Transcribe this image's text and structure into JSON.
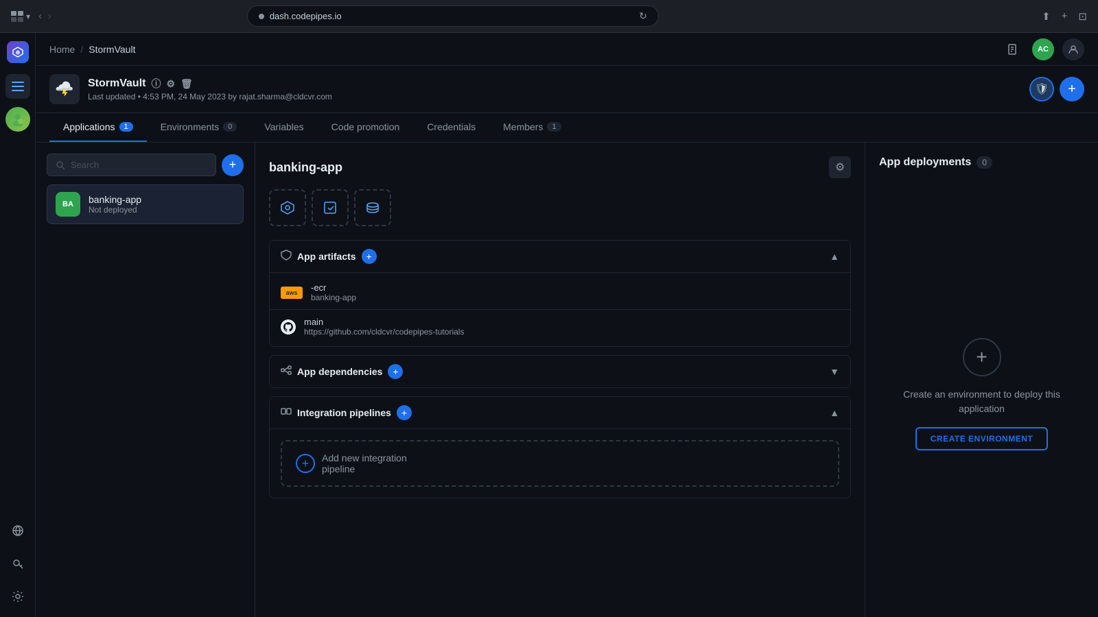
{
  "browser": {
    "url": "dash.codepipes.io",
    "reload_icon": "↻"
  },
  "breadcrumb": {
    "home": "Home",
    "separator": "/",
    "current": "StormVault"
  },
  "project": {
    "name": "StormVault",
    "last_updated": "Last updated • 4:53 PM, 24 May 2023 by rajat.sharma@cldcvr.com",
    "logo_emoji": "🌩️"
  },
  "tabs": [
    {
      "id": "applications",
      "label": "Applications",
      "badge": "1",
      "active": true
    },
    {
      "id": "environments",
      "label": "Environments",
      "badge": "0",
      "active": false
    },
    {
      "id": "variables",
      "label": "Variables",
      "badge": "",
      "active": false
    },
    {
      "id": "code-promotion",
      "label": "Code promotion",
      "badge": "",
      "active": false
    },
    {
      "id": "credentials",
      "label": "Credentials",
      "badge": "",
      "active": false
    },
    {
      "id": "members",
      "label": "Members",
      "badge": "1",
      "active": false
    }
  ],
  "search": {
    "placeholder": "Search"
  },
  "apps": [
    {
      "id": "banking-app",
      "name": "banking-app",
      "status": "Not deployed",
      "initials": "BA"
    }
  ],
  "app_detail": {
    "name": "banking-app",
    "sections": {
      "artifacts": {
        "title": "App artifacts",
        "items": [
          {
            "type": "ecr",
            "name": "-ecr",
            "sub": "banking-app"
          },
          {
            "type": "github",
            "name": "main",
            "sub": "https://github.com/cldcvr/codepipes-tutorials"
          }
        ]
      },
      "dependencies": {
        "title": "App dependencies"
      },
      "pipelines": {
        "title": "Integration pipelines",
        "add_label": "Add new integration\npipeline"
      }
    }
  },
  "deployments": {
    "title": "App deployments",
    "count": "0",
    "empty_text": "Create an environment to deploy this application",
    "create_btn": "CREATE ENVIRONMENT"
  },
  "user": {
    "initials": "AC"
  }
}
